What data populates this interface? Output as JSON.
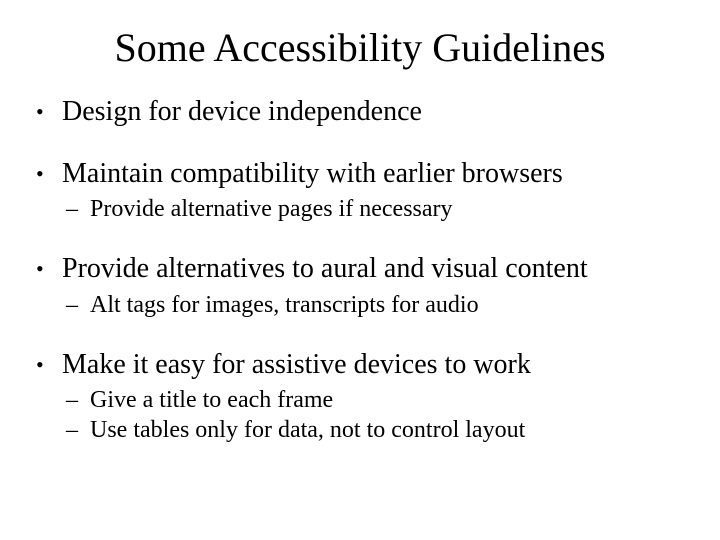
{
  "title": "Some Accessibility Guidelines",
  "bullets": [
    {
      "text": "Design for device independence",
      "subs": []
    },
    {
      "text": "Maintain compatibility with earlier browsers",
      "subs": [
        "Provide alternative pages if necessary"
      ]
    },
    {
      "text": "Provide alternatives to aural and visual content",
      "subs": [
        "Alt tags for images, transcripts for audio"
      ]
    },
    {
      "text": "Make it easy for assistive devices to work",
      "subs": [
        "Give a title to each frame",
        "Use tables only for data, not to control layout"
      ]
    }
  ]
}
